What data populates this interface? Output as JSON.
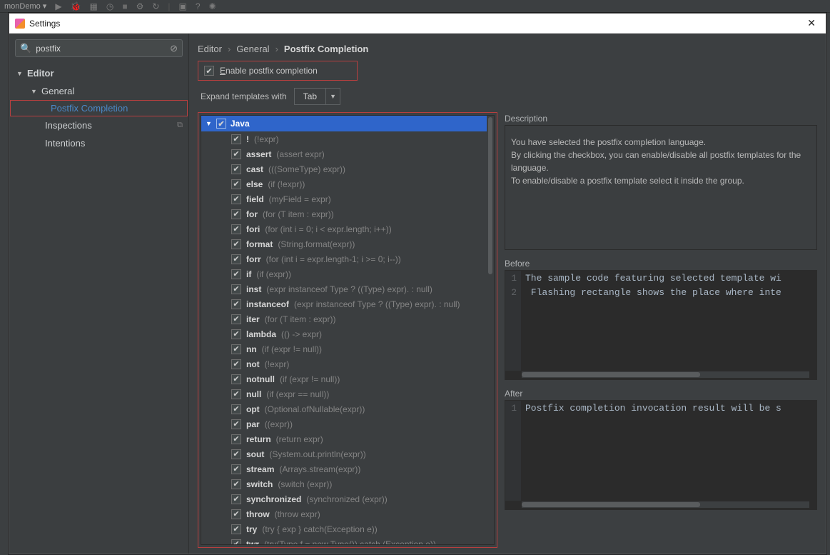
{
  "ide": {
    "config_name": "monDemo"
  },
  "window": {
    "title": "Settings"
  },
  "search": {
    "value": "postfix"
  },
  "sidebar": {
    "editor": "Editor",
    "general": "General",
    "postfix": "Postfix Completion",
    "inspections": "Inspections",
    "intentions": "Intentions"
  },
  "breadcrumb": {
    "a": "Editor",
    "b": "General",
    "c": "Postfix Completion"
  },
  "enable": {
    "label": "Enable postfix completion"
  },
  "expand": {
    "label": "Expand templates with",
    "value": "Tab"
  },
  "lang_header": "Java",
  "templates": [
    {
      "name": "!",
      "desc": "(!expr)"
    },
    {
      "name": "assert",
      "desc": "(assert expr)"
    },
    {
      "name": "cast",
      "desc": "(((SomeType) expr))"
    },
    {
      "name": "else",
      "desc": "(if (!expr))"
    },
    {
      "name": "field",
      "desc": "(myField = expr)"
    },
    {
      "name": "for",
      "desc": "(for (T item : expr))"
    },
    {
      "name": "fori",
      "desc": "(for (int i = 0; i < expr.length; i++))"
    },
    {
      "name": "format",
      "desc": "(String.format(expr))"
    },
    {
      "name": "forr",
      "desc": "(for (int i = expr.length-1; i >= 0; i--))"
    },
    {
      "name": "if",
      "desc": "(if (expr))"
    },
    {
      "name": "inst",
      "desc": "(expr instanceof Type ? ((Type) expr). : null)"
    },
    {
      "name": "instanceof",
      "desc": "(expr instanceof Type ? ((Type) expr). : null)"
    },
    {
      "name": "iter",
      "desc": "(for (T item : expr))"
    },
    {
      "name": "lambda",
      "desc": "(() -> expr)"
    },
    {
      "name": "nn",
      "desc": "(if (expr != null))"
    },
    {
      "name": "not",
      "desc": "(!expr)"
    },
    {
      "name": "notnull",
      "desc": "(if (expr != null))"
    },
    {
      "name": "null",
      "desc": "(if (expr == null))"
    },
    {
      "name": "opt",
      "desc": "(Optional.ofNullable(expr))"
    },
    {
      "name": "par",
      "desc": "((expr))"
    },
    {
      "name": "return",
      "desc": "(return expr)"
    },
    {
      "name": "sout",
      "desc": "(System.out.println(expr))"
    },
    {
      "name": "stream",
      "desc": "(Arrays.stream(expr))"
    },
    {
      "name": "switch",
      "desc": "(switch (expr))"
    },
    {
      "name": "synchronized",
      "desc": "(synchronized (expr))"
    },
    {
      "name": "throw",
      "desc": "(throw expr)"
    },
    {
      "name": "try",
      "desc": "(try { exp } catch(Exception e))"
    },
    {
      "name": "twr",
      "desc": "(try(Type f = new Type()) catch (Exception e))"
    }
  ],
  "description": {
    "label": "Description",
    "l1": "You have selected the postfix completion language.",
    "l2": "By clicking the checkbox, you can enable/disable all postfix templates for the language.",
    "l3": "To enable/disable a postfix template select it inside the group."
  },
  "before": {
    "label": "Before",
    "line1": "The sample code featuring selected template wi",
    "line2": " Flashing rectangle shows the place where inte"
  },
  "after": {
    "label": "After",
    "line1": "Postfix completion invocation result will be s"
  }
}
